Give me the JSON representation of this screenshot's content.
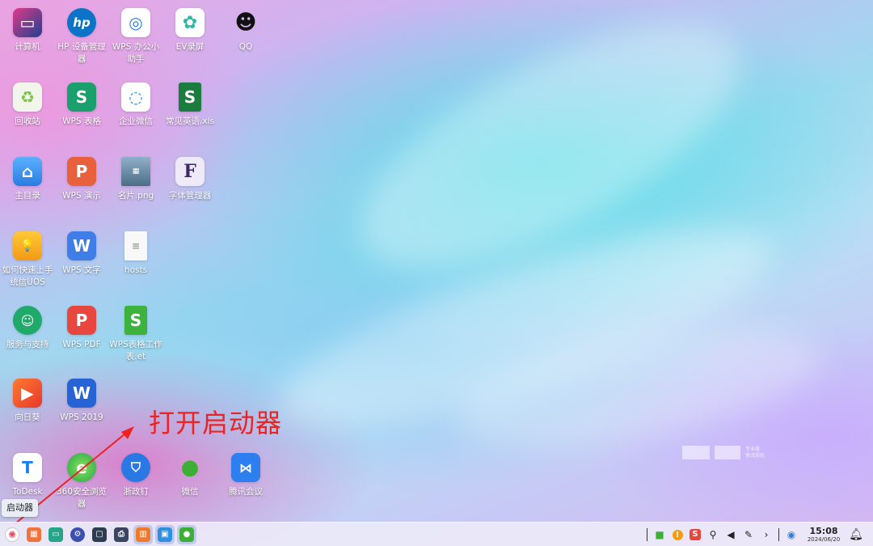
{
  "desktop_icons": [
    {
      "label": "计算机",
      "icon": "computer-icon",
      "color": "#1e3f8f"
    },
    {
      "label": "HP 设备管理器",
      "icon": "hp-icon",
      "color": "#0b74c9"
    },
    {
      "label": "WPS 办公小助手",
      "icon": "wps-assistant-icon",
      "color": "#2b7de9"
    },
    {
      "label": "EV录屏",
      "icon": "ev-recorder-icon",
      "color": "#2fb8a6"
    },
    {
      "label": "QQ",
      "icon": "qq-penguin-icon",
      "color": "#111111"
    },
    {
      "label": "回收站",
      "icon": "trash-icon",
      "color": "#7cc243"
    },
    {
      "label": "WPS 表格",
      "icon": "wps-spreadsheet-icon",
      "color": "#1aa06d"
    },
    {
      "label": "企业微信",
      "icon": "wecom-icon",
      "color": "#2b86e8"
    },
    {
      "label": "常见英语.xls",
      "icon": "xls-file-icon",
      "color": "#1a7c3e"
    },
    {
      "label": "主目录",
      "icon": "home-folder-icon",
      "color": "#3b8fe8"
    },
    {
      "label": "WPS 演示",
      "icon": "wps-presentation-icon",
      "color": "#e8603c"
    },
    {
      "label": "名片.png",
      "icon": "image-file-icon",
      "color": "#6f8fa8"
    },
    {
      "label": "字体管理器",
      "icon": "font-manager-icon",
      "color": "#5a3c8a"
    },
    {
      "label": "如何快速上手统信UOS",
      "icon": "uos-guide-icon",
      "color": "#f4a91c"
    },
    {
      "label": "WPS 文字",
      "icon": "wps-writer-icon",
      "color": "#3f7ee8"
    },
    {
      "label": "hosts",
      "icon": "text-file-icon",
      "color": "#f4f4f4"
    },
    {
      "label": "服务与支持",
      "icon": "support-icon",
      "color": "#1fa96a"
    },
    {
      "label": "WPS PDF",
      "icon": "wps-pdf-icon",
      "color": "#e8473f"
    },
    {
      "label": "WPS表格工作表.et",
      "icon": "et-file-icon",
      "color": "#3db23d"
    },
    {
      "label": "向日葵",
      "icon": "sunlogin-icon",
      "color": "#ee5a24"
    },
    {
      "label": "WPS 2019",
      "icon": "wps-2019-icon",
      "color": "#2563d6"
    },
    {
      "label": "ToDesk",
      "icon": "todesk-icon",
      "color": "#ffffff"
    },
    {
      "label": "360安全浏览器",
      "icon": "360-browser-icon",
      "color": "#20a84a"
    },
    {
      "label": "浙政钉",
      "icon": "zhezhengding-icon",
      "color": "#2a78e4"
    },
    {
      "label": "微信",
      "icon": "wechat-icon",
      "color": "#3cb034"
    },
    {
      "label": "腾讯会议",
      "icon": "tencent-meeting-icon",
      "color": "#2d7ff0"
    }
  ],
  "annotation": {
    "text": "打开启动器",
    "color": "#ee2222"
  },
  "tooltip": {
    "text": "启动器"
  },
  "taskbar": {
    "apps": [
      {
        "icon": "launcher-icon"
      },
      {
        "icon": "multitask-view-icon"
      },
      {
        "icon": "terminal-icon"
      },
      {
        "icon": "control-center-icon"
      },
      {
        "icon": "monitor-icon"
      },
      {
        "icon": "printer-icon"
      },
      {
        "icon": "app-store-icon"
      },
      {
        "icon": "window-icon"
      },
      {
        "icon": "wechat-icon"
      }
    ],
    "tray": [
      {
        "icon": "wechat-tray-icon"
      },
      {
        "icon": "alert-icon"
      },
      {
        "icon": "sogou-ime-icon"
      },
      {
        "icon": "usb-icon"
      },
      {
        "icon": "volume-icon"
      },
      {
        "icon": "pen-icon"
      },
      {
        "icon": "chevron-right-icon"
      },
      {
        "icon": "network-globe-icon"
      }
    ],
    "time": "15:08",
    "date": "2024/06/20",
    "notification_icon": "bell-icon"
  },
  "watermark": {
    "line1": "专业版",
    "line2": "激活授权"
  }
}
